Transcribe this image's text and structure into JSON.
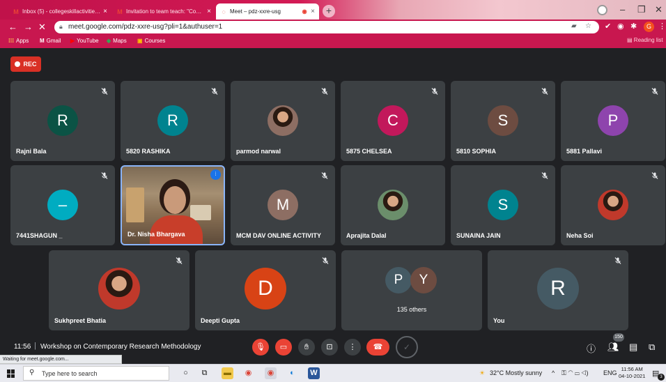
{
  "browser": {
    "tabs": [
      {
        "title": "Inbox (5) - collegeskillactivities@...",
        "icon": "gmail-icon"
      },
      {
        "title": "Invitation to team teach: \"Conte...",
        "icon": "gmail-icon"
      },
      {
        "title": "Meet – pdz-xxre-usg",
        "icon": "meet-icon"
      }
    ],
    "url": "meet.google.com/pdz-xxre-usg?pli=1&authuser=1",
    "profile_initial": "G",
    "bookmarks": [
      "Apps",
      "Gmail",
      "YouTube",
      "Maps",
      "Courses"
    ],
    "reading_list": "Reading list"
  },
  "meet": {
    "rec_label": "REC",
    "participants": [
      {
        "name": "Rajni Bala",
        "initial": "R",
        "color": "#0b5345",
        "muted": true
      },
      {
        "name": "5820 RASHIKA",
        "initial": "R",
        "color": "#00838f",
        "muted": true
      },
      {
        "name": "parmod narwal",
        "initial": "",
        "color": "#8d6e63",
        "muted": true,
        "photo": true
      },
      {
        "name": "5875 CHELSEA",
        "initial": "C",
        "color": "#c2185b",
        "muted": true
      },
      {
        "name": "5810 SOPHIA",
        "initial": "S",
        "color": "#6d4c41",
        "muted": true
      },
      {
        "name": "5881 Pallavi",
        "initial": "P",
        "color": "#8e44ad",
        "muted": true
      },
      {
        "name": "7441SHAGUN _",
        "initial": "–",
        "color": "#00acc1",
        "muted": true
      },
      {
        "name": "Dr. Nisha Bhargava",
        "initial": "",
        "color": "#b0a08a",
        "muted": false,
        "video": true
      },
      {
        "name": "MCM DAV ONLINE ACTIVITY",
        "initial": "M",
        "color": "#8d6e63",
        "muted": true
      },
      {
        "name": "Aprajita Dalal",
        "initial": "",
        "color": "#6b8e6b",
        "muted": false,
        "photo": true
      },
      {
        "name": "SUNAINA JAIN",
        "initial": "S",
        "color": "#00838f",
        "muted": true
      },
      {
        "name": "Neha Soi",
        "initial": "",
        "color": "#c0392b",
        "muted": true,
        "photo": true
      },
      {
        "name": "Sukhpreet Bhatia",
        "initial": "",
        "color": "#c0392b",
        "muted": true,
        "photo": true
      },
      {
        "name": "Deepti Gupta",
        "initial": "D",
        "color": "#d84315",
        "muted": true
      },
      {
        "name": "You",
        "initial": "R",
        "color": "#455a64",
        "muted": true
      }
    ],
    "others": {
      "initials": [
        "P",
        "Y"
      ],
      "colors": [
        "#455a64",
        "#6d4c41"
      ],
      "count_label": "135 others"
    },
    "time": "11:56",
    "separator": "|",
    "meeting_title": "Workshop on Contemporary Research Methodology",
    "people_count": "150",
    "loading_status": "Waiting for meet.google.com..."
  },
  "taskbar": {
    "search_placeholder": "Type here to search",
    "weather": "32°C  Mostly sunny",
    "language": "ENG",
    "time": "11:56 AM",
    "date": "04-10-2021",
    "notification_count": "3"
  }
}
